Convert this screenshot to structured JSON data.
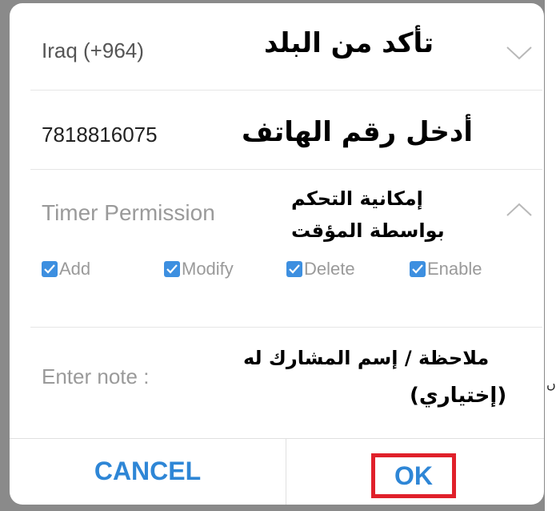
{
  "country": {
    "value": "Iraq (+964)",
    "annotation": "تأكد من البلد"
  },
  "phone": {
    "value": "7818816075",
    "annotation": "أدخل رقم الهاتف"
  },
  "timer": {
    "label": "Timer Permission",
    "annotation_line1": "إمكانية التحكم",
    "annotation_line2": "بواسطة المؤقت",
    "options": [
      {
        "label": "Add",
        "checked": true
      },
      {
        "label": "Modify",
        "checked": true
      },
      {
        "label": "Delete",
        "checked": true
      },
      {
        "label": "Enable",
        "checked": true
      }
    ]
  },
  "note": {
    "placeholder": "Enter note :",
    "annotation_line1": "ملاحظة / إسم المشارك له",
    "annotation_line2": "(إختياري)"
  },
  "buttons": {
    "cancel": "CANCEL",
    "ok": "OK"
  },
  "stray_char": "ں",
  "colors": {
    "accent": "#2e86d6",
    "checkbox": "#3d8fe0",
    "highlight": "#e0202a",
    "backdrop": "#8a8a8a"
  }
}
